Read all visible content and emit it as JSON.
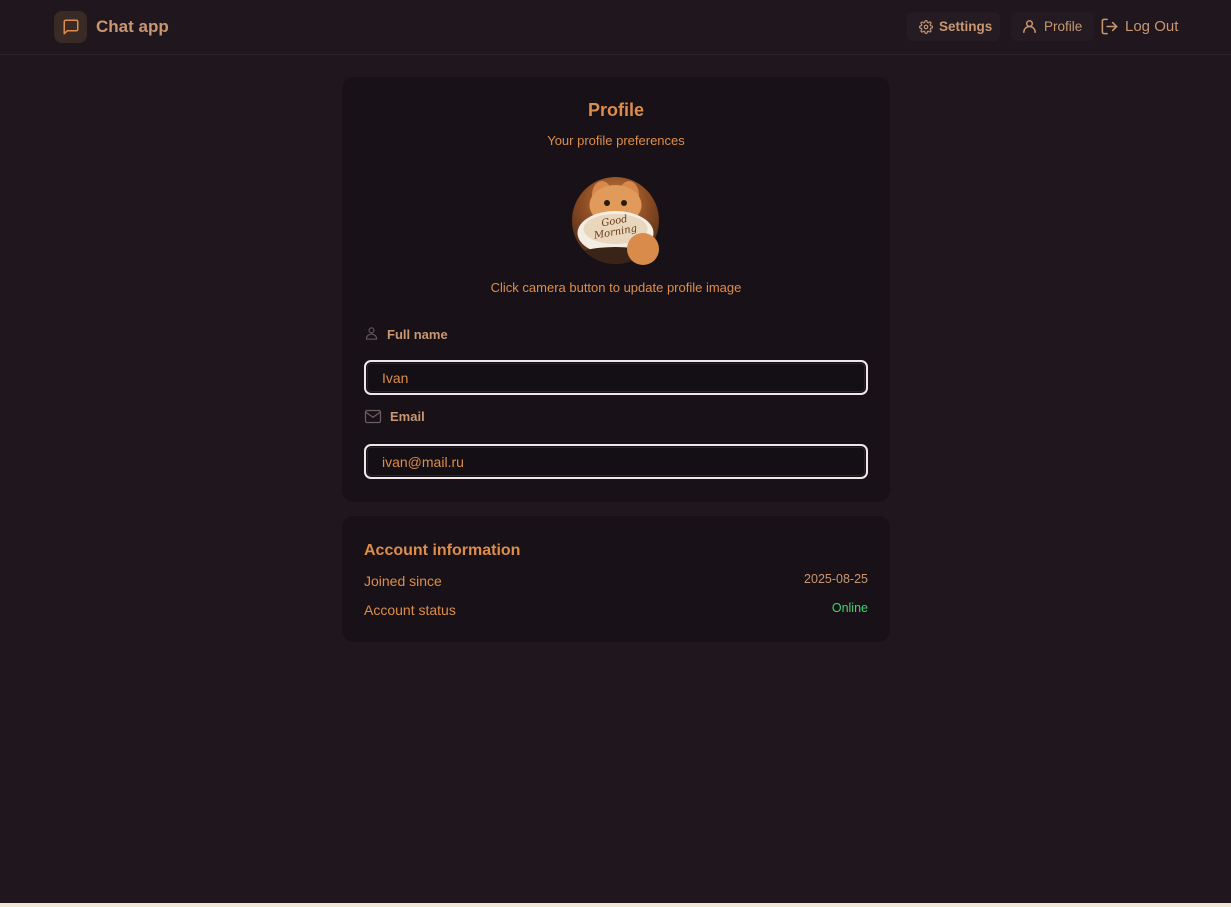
{
  "navbar": {
    "brand": "Chat app",
    "settings_label": "Settings",
    "profile_label": "Profile",
    "logout_label": "Log Out"
  },
  "profile": {
    "title": "Profile",
    "subtitle": "Your profile preferences",
    "avatar_hint": "Click camera button to update profile image",
    "avatar_image_text": "Good Morning",
    "full_name_label": "Full name",
    "full_name_value": "Ivan",
    "email_label": "Email",
    "email_value": "ivan@mail.ru"
  },
  "account": {
    "title": "Account information",
    "joined_label": "Joined since",
    "joined_value": "2025-08-25",
    "status_label": "Account status",
    "status_value": "Online"
  },
  "colors": {
    "background": "#1f161e",
    "card": "#181218",
    "accent": "#dd8d4a",
    "status_online": "#3ed46c"
  },
  "icons": [
    "message-square-icon",
    "gear-icon",
    "user-icon",
    "logout-icon",
    "camera-icon",
    "mail-icon"
  ]
}
